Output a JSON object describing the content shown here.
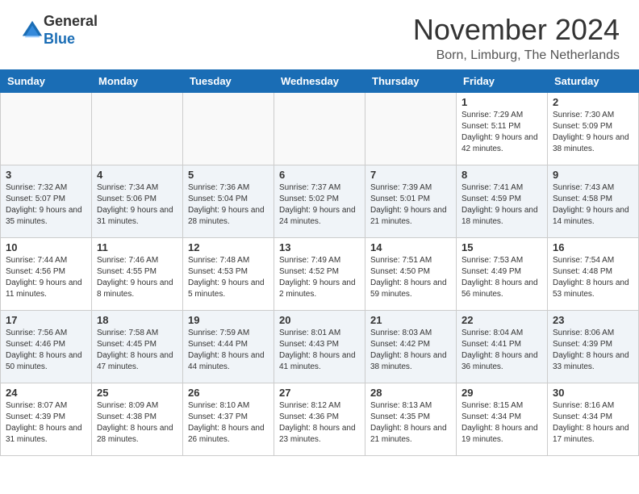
{
  "header": {
    "logo_general": "General",
    "logo_blue": "Blue",
    "month_title": "November 2024",
    "location": "Born, Limburg, The Netherlands"
  },
  "weekdays": [
    "Sunday",
    "Monday",
    "Tuesday",
    "Wednesday",
    "Thursday",
    "Friday",
    "Saturday"
  ],
  "weeks": [
    [
      {
        "day": "",
        "info": ""
      },
      {
        "day": "",
        "info": ""
      },
      {
        "day": "",
        "info": ""
      },
      {
        "day": "",
        "info": ""
      },
      {
        "day": "",
        "info": ""
      },
      {
        "day": "1",
        "info": "Sunrise: 7:29 AM\nSunset: 5:11 PM\nDaylight: 9 hours and 42 minutes."
      },
      {
        "day": "2",
        "info": "Sunrise: 7:30 AM\nSunset: 5:09 PM\nDaylight: 9 hours and 38 minutes."
      }
    ],
    [
      {
        "day": "3",
        "info": "Sunrise: 7:32 AM\nSunset: 5:07 PM\nDaylight: 9 hours and 35 minutes."
      },
      {
        "day": "4",
        "info": "Sunrise: 7:34 AM\nSunset: 5:06 PM\nDaylight: 9 hours and 31 minutes."
      },
      {
        "day": "5",
        "info": "Sunrise: 7:36 AM\nSunset: 5:04 PM\nDaylight: 9 hours and 28 minutes."
      },
      {
        "day": "6",
        "info": "Sunrise: 7:37 AM\nSunset: 5:02 PM\nDaylight: 9 hours and 24 minutes."
      },
      {
        "day": "7",
        "info": "Sunrise: 7:39 AM\nSunset: 5:01 PM\nDaylight: 9 hours and 21 minutes."
      },
      {
        "day": "8",
        "info": "Sunrise: 7:41 AM\nSunset: 4:59 PM\nDaylight: 9 hours and 18 minutes."
      },
      {
        "day": "9",
        "info": "Sunrise: 7:43 AM\nSunset: 4:58 PM\nDaylight: 9 hours and 14 minutes."
      }
    ],
    [
      {
        "day": "10",
        "info": "Sunrise: 7:44 AM\nSunset: 4:56 PM\nDaylight: 9 hours and 11 minutes."
      },
      {
        "day": "11",
        "info": "Sunrise: 7:46 AM\nSunset: 4:55 PM\nDaylight: 9 hours and 8 minutes."
      },
      {
        "day": "12",
        "info": "Sunrise: 7:48 AM\nSunset: 4:53 PM\nDaylight: 9 hours and 5 minutes."
      },
      {
        "day": "13",
        "info": "Sunrise: 7:49 AM\nSunset: 4:52 PM\nDaylight: 9 hours and 2 minutes."
      },
      {
        "day": "14",
        "info": "Sunrise: 7:51 AM\nSunset: 4:50 PM\nDaylight: 8 hours and 59 minutes."
      },
      {
        "day": "15",
        "info": "Sunrise: 7:53 AM\nSunset: 4:49 PM\nDaylight: 8 hours and 56 minutes."
      },
      {
        "day": "16",
        "info": "Sunrise: 7:54 AM\nSunset: 4:48 PM\nDaylight: 8 hours and 53 minutes."
      }
    ],
    [
      {
        "day": "17",
        "info": "Sunrise: 7:56 AM\nSunset: 4:46 PM\nDaylight: 8 hours and 50 minutes."
      },
      {
        "day": "18",
        "info": "Sunrise: 7:58 AM\nSunset: 4:45 PM\nDaylight: 8 hours and 47 minutes."
      },
      {
        "day": "19",
        "info": "Sunrise: 7:59 AM\nSunset: 4:44 PM\nDaylight: 8 hours and 44 minutes."
      },
      {
        "day": "20",
        "info": "Sunrise: 8:01 AM\nSunset: 4:43 PM\nDaylight: 8 hours and 41 minutes."
      },
      {
        "day": "21",
        "info": "Sunrise: 8:03 AM\nSunset: 4:42 PM\nDaylight: 8 hours and 38 minutes."
      },
      {
        "day": "22",
        "info": "Sunrise: 8:04 AM\nSunset: 4:41 PM\nDaylight: 8 hours and 36 minutes."
      },
      {
        "day": "23",
        "info": "Sunrise: 8:06 AM\nSunset: 4:39 PM\nDaylight: 8 hours and 33 minutes."
      }
    ],
    [
      {
        "day": "24",
        "info": "Sunrise: 8:07 AM\nSunset: 4:39 PM\nDaylight: 8 hours and 31 minutes."
      },
      {
        "day": "25",
        "info": "Sunrise: 8:09 AM\nSunset: 4:38 PM\nDaylight: 8 hours and 28 minutes."
      },
      {
        "day": "26",
        "info": "Sunrise: 8:10 AM\nSunset: 4:37 PM\nDaylight: 8 hours and 26 minutes."
      },
      {
        "day": "27",
        "info": "Sunrise: 8:12 AM\nSunset: 4:36 PM\nDaylight: 8 hours and 23 minutes."
      },
      {
        "day": "28",
        "info": "Sunrise: 8:13 AM\nSunset: 4:35 PM\nDaylight: 8 hours and 21 minutes."
      },
      {
        "day": "29",
        "info": "Sunrise: 8:15 AM\nSunset: 4:34 PM\nDaylight: 8 hours and 19 minutes."
      },
      {
        "day": "30",
        "info": "Sunrise: 8:16 AM\nSunset: 4:34 PM\nDaylight: 8 hours and 17 minutes."
      }
    ]
  ]
}
